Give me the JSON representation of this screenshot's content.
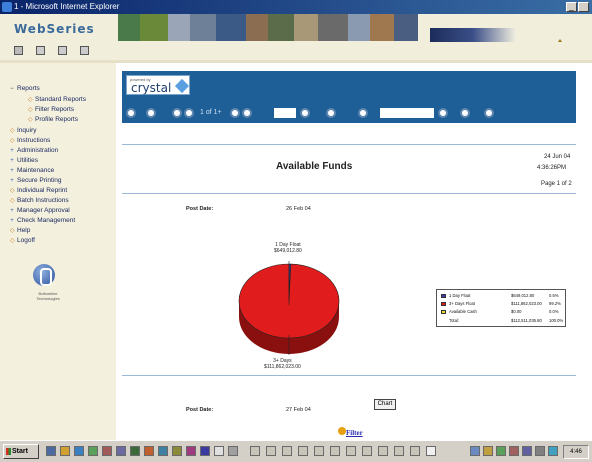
{
  "window": {
    "title": "1 - Microsoft Internet Explorer",
    "minimize_glyph": "_"
  },
  "app": {
    "brand": "WebSeries"
  },
  "nav": {
    "items": [
      {
        "label": "Reports",
        "expanded": true
      },
      {
        "label": "Standard Reports",
        "sub": true
      },
      {
        "label": "Filter Reports",
        "sub": true
      },
      {
        "label": "Profile Reports",
        "sub": true
      },
      {
        "label": "Inquiry"
      },
      {
        "label": "Instructions"
      },
      {
        "label": "Administration"
      },
      {
        "label": "Utilities"
      },
      {
        "label": "Maintenance"
      },
      {
        "label": "Secure Printing"
      },
      {
        "label": "Individual Reprint"
      },
      {
        "label": "Batch Instructions"
      },
      {
        "label": "Manager Approval"
      },
      {
        "label": "Check Management"
      },
      {
        "label": "Help"
      },
      {
        "label": "Logoff"
      }
    ],
    "logo_caption": [
      "Bottomline",
      "Technologies"
    ]
  },
  "viewer": {
    "powered_by": "powered by",
    "product": "crystal",
    "page_indicator": "1 of 1+"
  },
  "report": {
    "title": "Available Funds",
    "date": "24 Jun 04",
    "time": "4:36:26PM",
    "page": "Page 1 of 2",
    "post_date_label": "Post Date:",
    "post_date_1": "26 Feb 04",
    "post_date_2": "27 Feb 04",
    "chart_button": "Chart",
    "filter_link": "Filter"
  },
  "chart_data": {
    "type": "pie",
    "slice_labels": [
      {
        "line1": "1 Day Float",
        "line2": "$649,012.80"
      },
      {
        "line1": "3+ Days",
        "line2": "$111,862,023.00"
      }
    ],
    "series": [
      {
        "name": "1 Day Float",
        "amount": "$649,012.80",
        "pct": "0.6%",
        "value": 0.6,
        "color": "#3a3aa8"
      },
      {
        "name": "3+ Days Float",
        "amount": "$111,862,023.00",
        "pct": "99.2%",
        "value": 99.2,
        "color": "#e01c1c"
      },
      {
        "name": "Available Cash",
        "amount": "$0.00",
        "pct": "0.0%",
        "value": 0.0,
        "color": "#e8d830"
      }
    ],
    "total": {
      "name": "Total:",
      "amount": "$112,511,035.80",
      "pct": "100.0%"
    }
  },
  "taskbar": {
    "start": "Start",
    "clock": "4:46"
  }
}
